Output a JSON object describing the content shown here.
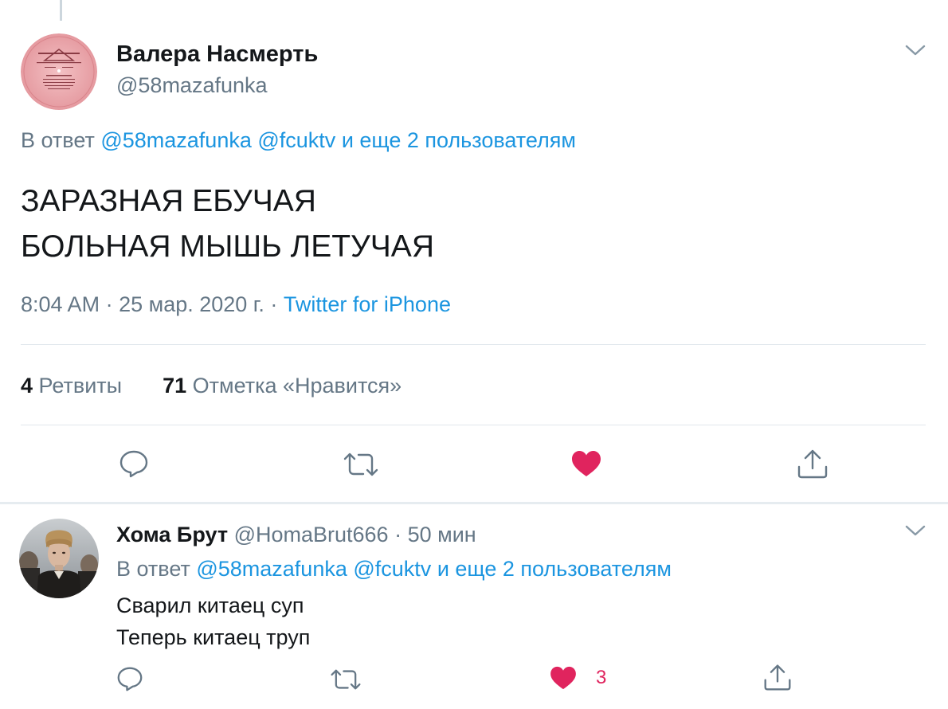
{
  "main_tweet": {
    "author": {
      "name": "Валера Насмерть",
      "handle": "@58mazafunka",
      "avatar": "vinyl-record-label-avatar"
    },
    "reply_to": {
      "prefix": "В ответ",
      "mention_1": "@58mazafunka",
      "mention_2": "@fcuktv",
      "suffix": "и еще 2 пользователям"
    },
    "text_line_1": "ЗАРАЗНАЯ ЕБУЧАЯ",
    "text_line_2": "БОЛЬНАЯ МЫШЬ ЛЕТУЧАЯ",
    "meta": {
      "time": "8:04 AM",
      "sep_1": "·",
      "date": "25 мар. 2020 г.",
      "sep_2": "·",
      "source": "Twitter for iPhone"
    },
    "stats": {
      "retweets_count": "4",
      "retweets_label": "Ретвиты",
      "likes_count": "71",
      "likes_label": "Отметка «Нравится»"
    },
    "actions": [
      "reply-icon",
      "retweet-icon",
      "like-icon-filled",
      "share-icon"
    ],
    "liked": true
  },
  "reply_tweet": {
    "author": {
      "name": "Хома Брут",
      "handle": "@HomaBrut666",
      "sep": "·",
      "time": "50 мин",
      "avatar": "person-photo-avatar"
    },
    "reply_to": {
      "prefix": "В ответ",
      "mention_1": "@58mazafunka",
      "mention_2": "@fcuktv",
      "suffix": "и еще 2 пользователям"
    },
    "text_line_1": "Сварил китаец суп",
    "text_line_2": "Теперь китаец труп",
    "like_count": "3",
    "liked": true
  },
  "colors": {
    "link": "#1b95e0",
    "muted": "#657786",
    "like": "#e0245e",
    "divider": "#e1e8ed"
  }
}
